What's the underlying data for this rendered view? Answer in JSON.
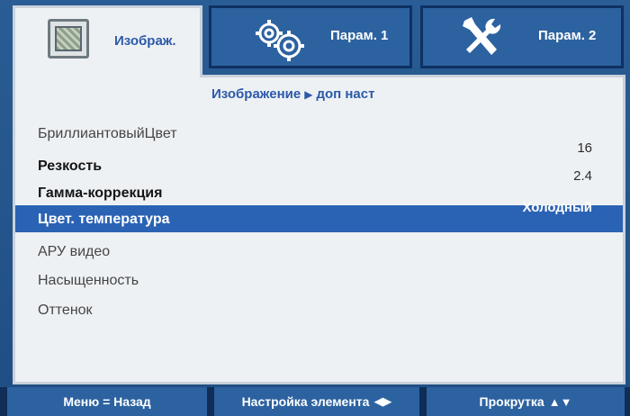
{
  "tabs": {
    "image": {
      "label": "Изображ.",
      "icon": "image-settings-icon"
    },
    "param1": {
      "label": "Парам. 1",
      "icon": "gears-icon"
    },
    "param2": {
      "label": "Парам. 2",
      "icon": "tools-icon"
    }
  },
  "breadcrumb": {
    "section": "Изображение",
    "page": "доп наст"
  },
  "menu": [
    {
      "label": "БриллиантовыйЦвет",
      "value": ""
    },
    {
      "label": "Резкость",
      "value": "16"
    },
    {
      "label": "Гамма-коррекция",
      "value": "2.4"
    },
    {
      "label": "Цвет. температура",
      "value": "Холодный"
    },
    {
      "label": "АРУ видео",
      "value": ""
    },
    {
      "label": "Насыщенность",
      "value": ""
    },
    {
      "label": "Оттенок",
      "value": ""
    }
  ],
  "footer": {
    "menu_back": "Меню = Назад",
    "adjust": "Настройка элемента",
    "scroll": "Прокрутка"
  },
  "colors": {
    "accent": "#2c5aa8",
    "selected_row": "#2b63b4",
    "tab_inactive": "#2d62a0",
    "panel_bg": "#eef1f4"
  }
}
